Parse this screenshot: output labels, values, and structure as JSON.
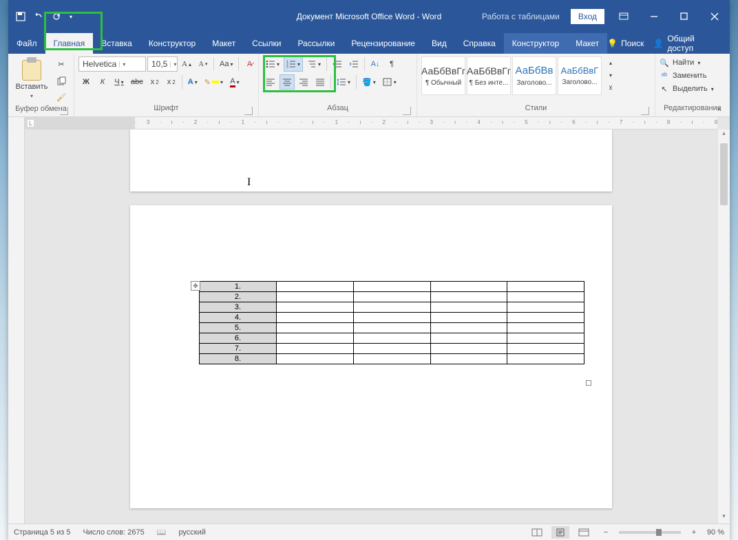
{
  "title": "Документ Microsoft Office Word  -  Word",
  "table_context": "Работа с таблицами",
  "account": "Вход",
  "tabs": {
    "file": "Файл",
    "home": "Главная",
    "insert": "Вставка",
    "design": "Конструктор",
    "layout": "Макет",
    "references": "Ссылки",
    "mailings": "Рассылки",
    "review": "Рецензирование",
    "view": "Вид",
    "help": "Справка",
    "tbl_design": "Конструктор",
    "tbl_layout": "Макет"
  },
  "tell_me": "Поиск",
  "share": "Общий доступ",
  "ribbon": {
    "clipboard": {
      "paste": "Вставить",
      "label": "Буфер обмена"
    },
    "font": {
      "name": "Helvetica",
      "size": "10,5",
      "bold": "Ж",
      "italic": "К",
      "underline": "Ч",
      "label": "Шрифт"
    },
    "paragraph": {
      "label": "Абзац"
    },
    "styles": {
      "label": "Стили",
      "sample": "АаБбВвГг",
      "sample_h": "АаБбВв",
      "sample_h2": "АаБбВвГ",
      "items": [
        "¶ Обычный",
        "¶ Без инте...",
        "Заголово...",
        "Заголово..."
      ]
    },
    "editing": {
      "label": "Редактирование",
      "find": "Найти",
      "replace": "Заменить",
      "select": "Выделить"
    }
  },
  "table": {
    "rows": [
      "1.",
      "2.",
      "3.",
      "4.",
      "5.",
      "6.",
      "7.",
      "8."
    ],
    "cols": 5
  },
  "status": {
    "page": "Страница 5 из 5",
    "words": "Число слов: 2675",
    "lang": "русский",
    "zoom": "90 %"
  }
}
